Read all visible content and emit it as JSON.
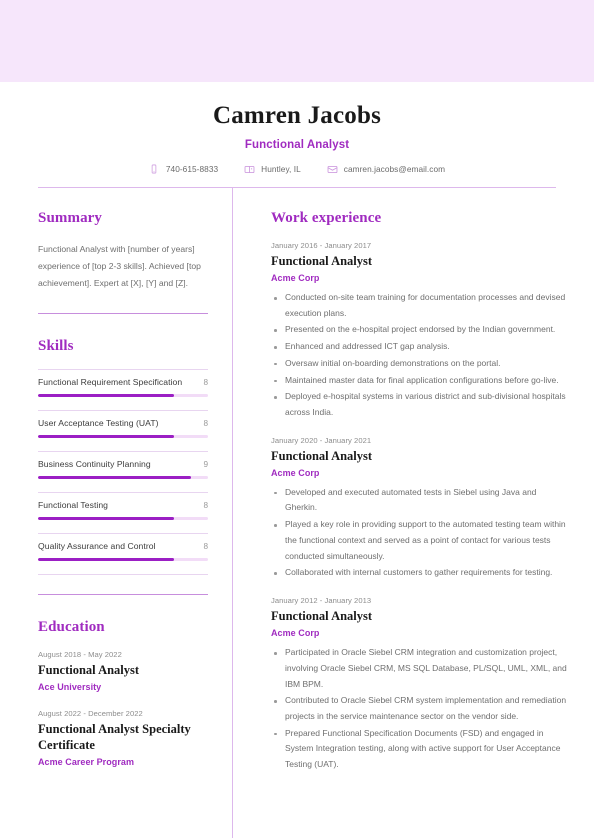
{
  "theme": {
    "banner_color": "#f6e6fb",
    "accent_color": "#a02bc0",
    "bar_fill_color": "#9b1fc4",
    "bar_track_color": "#f2dcf7",
    "rule_color": "#ddb8ec",
    "body_text_color": "#6f6f6f"
  },
  "header": {
    "name": "Camren Jacobs",
    "title": "Functional Analyst",
    "contacts": [
      {
        "icon": "phone-icon",
        "value": "740-615-8833"
      },
      {
        "icon": "location-icon",
        "value": "Huntley, IL"
      },
      {
        "icon": "email-icon",
        "value": "camren.jacobs@email.com"
      }
    ]
  },
  "left": {
    "summary": {
      "heading": "Summary",
      "text": "Functional Analyst with [number of years] experience of [top 2-3 skills]. Achieved [top achievement]. Expert at [X], [Y] and [Z]."
    },
    "skills": {
      "heading": "Skills",
      "max_score": 10,
      "items": [
        {
          "name": "Functional Requirement Specification",
          "score": "8",
          "percent": 80
        },
        {
          "name": "User Acceptance Testing (UAT)",
          "score": "8",
          "percent": 80
        },
        {
          "name": "Business Continuity Planning",
          "score": "9",
          "percent": 90
        },
        {
          "name": "Functional Testing",
          "score": "8",
          "percent": 80
        },
        {
          "name": "Quality Assurance and Control",
          "score": "8",
          "percent": 80
        }
      ]
    },
    "education": {
      "heading": "Education",
      "items": [
        {
          "date": "August 2018 - May 2022",
          "title": "Functional Analyst",
          "org": "Ace University"
        },
        {
          "date": "August 2022 - December 2022",
          "title": "Functional Analyst Specialty Certificate",
          "org": "Acme Career Program"
        }
      ]
    }
  },
  "right": {
    "work": {
      "heading": "Work experience",
      "items": [
        {
          "date": "January 2016 - January 2017",
          "title": "Functional Analyst",
          "org": "Acme Corp",
          "bullets": [
            "Conducted on-site team training for documentation processes and devised execution plans.",
            "Presented on the e-hospital project endorsed by the Indian government.",
            "Enhanced and addressed ICT gap analysis.",
            "Oversaw initial on-boarding demonstrations on the portal.",
            "Maintained master data for final application configurations before go-live.",
            "Deployed e-hospital systems in various district and sub-divisional hospitals across India."
          ]
        },
        {
          "date": "January 2020 - January 2021",
          "title": "Functional Analyst",
          "org": "Acme Corp",
          "bullets": [
            "Developed and executed automated tests in Siebel using Java and Gherkin.",
            "Played a key role in providing support to the automated testing team within the functional context and served as a point of contact for various tests conducted simultaneously.",
            "Collaborated with internal customers to gather requirements for testing."
          ]
        },
        {
          "date": "January 2012 - January 2013",
          "title": "Functional Analyst",
          "org": "Acme Corp",
          "bullets": [
            "Participated in Oracle Siebel CRM integration and customization project, involving Oracle Siebel CRM, MS SQL Database, PL/SQL, UML, XML, and IBM BPM.",
            "Contributed to Oracle Siebel CRM system implementation and remediation projects in the service maintenance sector on the vendor side.",
            "Prepared Functional Specification Documents (FSD) and engaged in System Integration testing, along with active support for User Acceptance Testing (UAT)."
          ]
        }
      ]
    }
  }
}
